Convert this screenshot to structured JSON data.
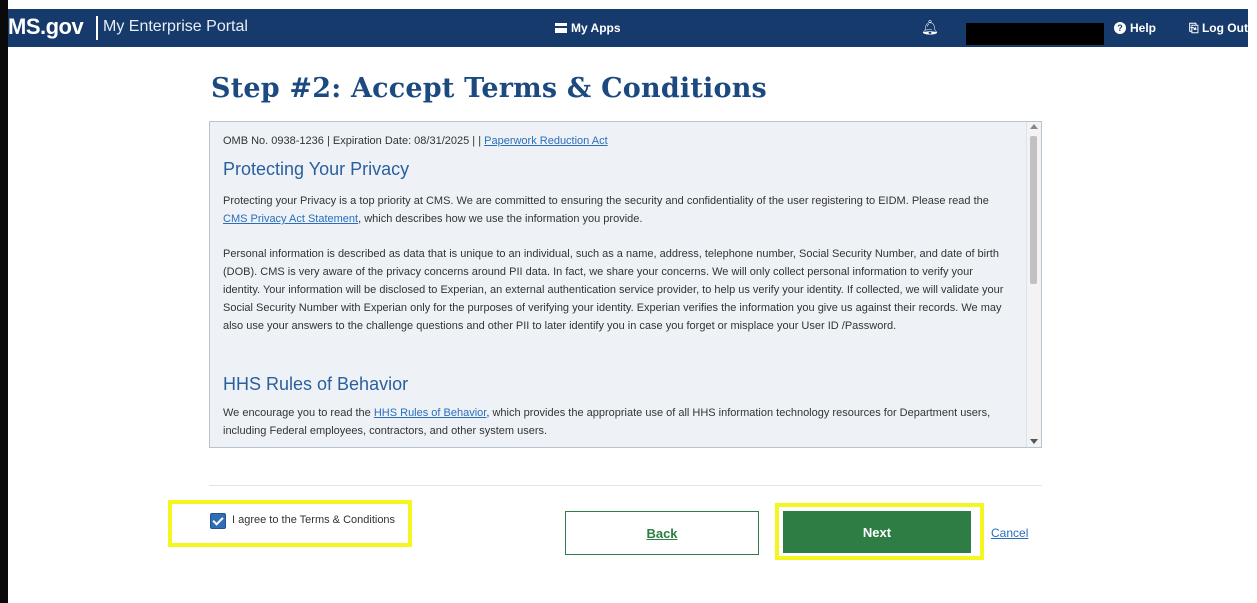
{
  "header": {
    "brand": "MS.gov",
    "portal_name": "My Enterprise Portal",
    "my_apps": "My Apps",
    "help": "Help",
    "logout": "Log Out"
  },
  "page": {
    "title": "Step #2: Accept Terms & Conditions"
  },
  "terms": {
    "omb_prefix": "OMB No. 0938-1236 | Expiration Date: 08/31/2025 | | ",
    "omb_link": "Paperwork Reduction Act",
    "privacy_heading": "Protecting Your Privacy",
    "privacy_p1_before": "Protecting your Privacy is a top priority at CMS. We are committed to ensuring the security and confidentiality of the user registering to EIDM. Please read the ",
    "privacy_p1_link": "CMS Privacy Act Statement",
    "privacy_p1_after": ", which describes how we use the information you provide.",
    "privacy_p2": "Personal information is described as data that is unique to an individual, such as a name, address, telephone number, Social Security Number, and date of birth (DOB). CMS is very aware of the privacy concerns around PII data. In fact, we share your concerns. We will only collect personal information to verify your identity. Your information will be disclosed to Experian, an external authentication service provider, to help us verify your identity. If collected, we will validate your Social Security Number with Experian only for the purposes of verifying your identity. Experian verifies the information you give us against their records. We may also use your answers to the challenge questions and other PII to later identify you in case you forget or misplace your User ID /Password.",
    "hhs_heading": "HHS Rules of Behavior",
    "hhs_p_before": "We encourage you to read the ",
    "hhs_p_link": "HHS Rules of Behavior",
    "hhs_p_after": ", which provides the appropriate use of all HHS information technology resources for Department users, including Federal employees, contractors, and other system users."
  },
  "agreement": {
    "checkbox_label": "I agree to the Terms & Conditions",
    "checked": true
  },
  "actions": {
    "back": "Back",
    "next": "Next",
    "cancel": "Cancel"
  },
  "colors": {
    "header_bg": "#163a6b",
    "title": "#1c4a80",
    "primary_green": "#2e7d44",
    "link": "#2a6ebb",
    "highlight": "#f5f51f"
  },
  "icons": [
    "grid-icon",
    "bell-icon",
    "help-icon",
    "logout-icon",
    "checkmark-icon"
  ]
}
